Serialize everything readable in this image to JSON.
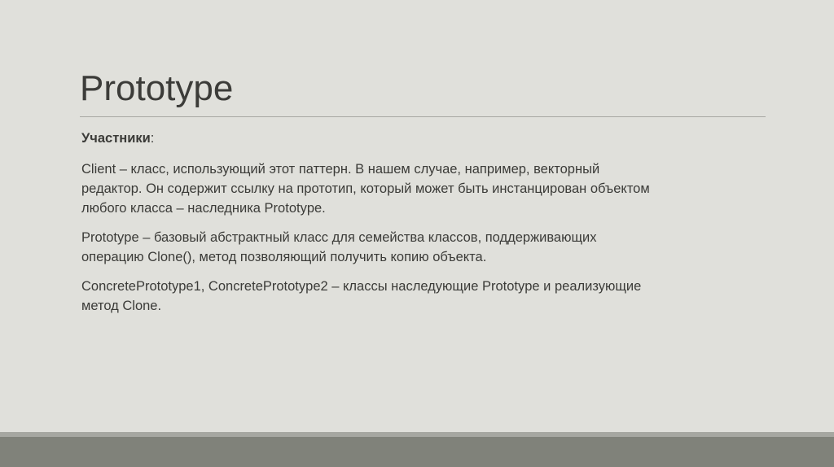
{
  "slide": {
    "title": "Prototype",
    "heading": "Участники",
    "heading_colon": ":",
    "paragraphs": [
      {
        "lines": [
          "Client – класс, использующий этот паттерн. В нашем случае, например, векторный",
          "редактор. Он содержит ссылку на прототип, который может быть инстанцирован объектом",
          "любого класса – наследника Prototype."
        ]
      },
      {
        "lines": [
          "Prototype – базовый абстрактный класс для семейства классов, поддерживающих",
          "операцию Clone(), метод позволяющий получить копию объекта."
        ]
      },
      {
        "lines": [
          "ConcretePrototype1, ConcretePrototype2 – классы наследующие Prototype и реализующие",
          "метод Clone."
        ]
      }
    ]
  },
  "colors": {
    "background": "#e0e0db",
    "footer_band": "#80827a",
    "text": "#3b3b38"
  }
}
